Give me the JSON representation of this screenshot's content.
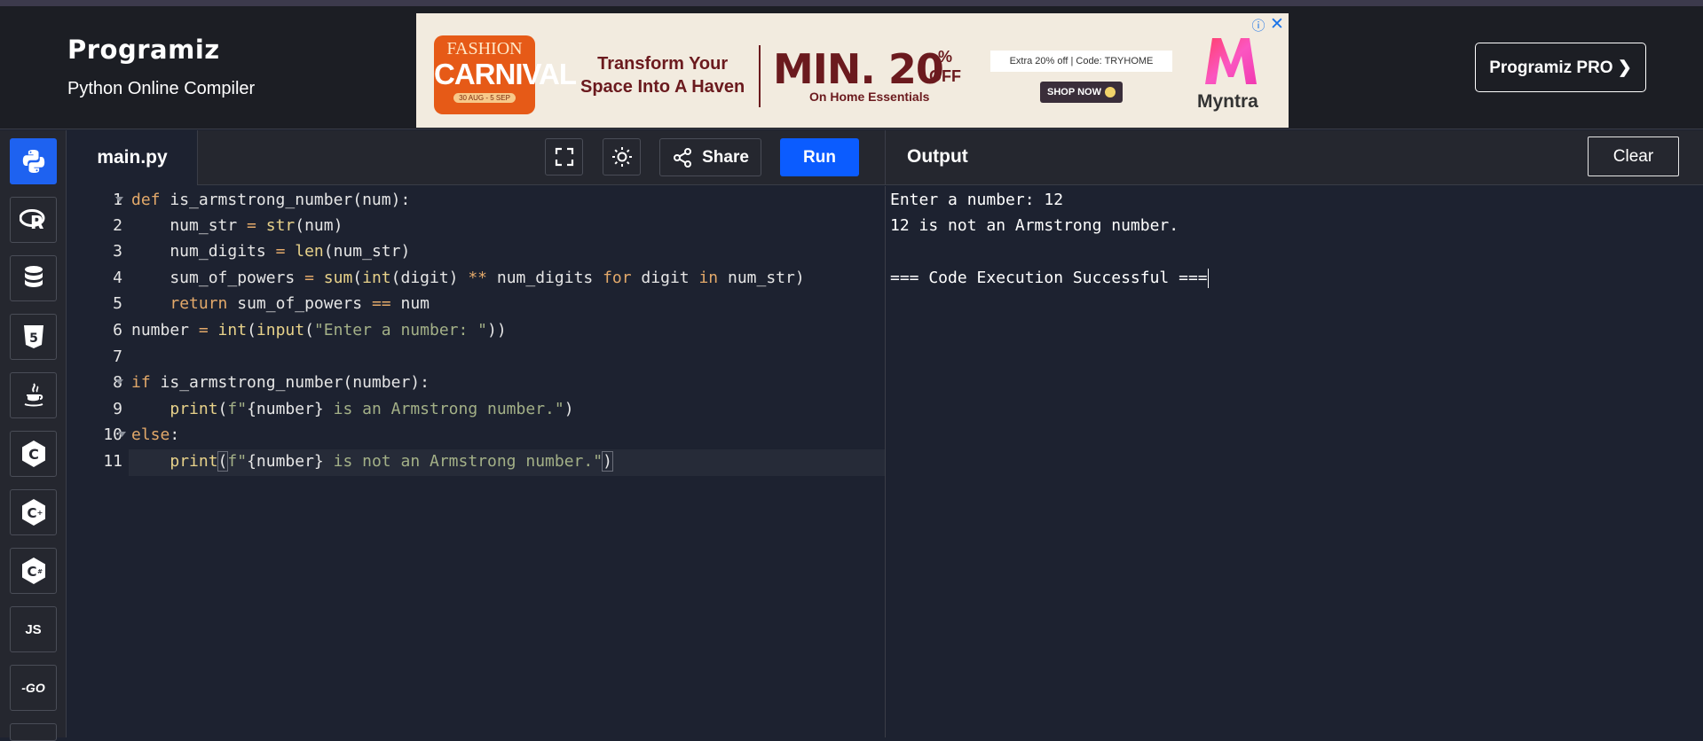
{
  "header": {
    "logo": "Programiz",
    "subtitle": "Python Online Compiler",
    "pro_button": "Programiz PRO ❯"
  },
  "ad": {
    "badge_top": "FASHION",
    "badge_main": "CARNIVAL",
    "badge_dates": "30 AUG - 5 SEP",
    "headline_1": "Transform Your",
    "headline_2": "Space Into A Haven",
    "min_text": "MIN. 20",
    "pct_1": "%",
    "pct_2": "OFF",
    "subtext": "On Home Essentials",
    "code_text": "Extra 20% off | Code: TRYHOME",
    "shop_now": "SHOP NOW",
    "brand": "Myntra",
    "info": "ⓘ",
    "close": "✕"
  },
  "sidebar": {
    "languages": [
      {
        "name": "python",
        "label": ""
      },
      {
        "name": "r",
        "label": "R"
      },
      {
        "name": "sql",
        "label": ""
      },
      {
        "name": "html",
        "label": "5"
      },
      {
        "name": "java",
        "label": ""
      },
      {
        "name": "c",
        "label": "C"
      },
      {
        "name": "cpp",
        "label": "C+"
      },
      {
        "name": "csharp",
        "label": "C#"
      },
      {
        "name": "js",
        "label": "JS"
      },
      {
        "name": "go",
        "label": "-GO"
      }
    ]
  },
  "editor": {
    "tab": "main.py",
    "share": "Share",
    "run": "Run",
    "line_numbers": [
      "1",
      "2",
      "3",
      "4",
      "5",
      "6",
      "7",
      "8",
      "9",
      "10",
      "11"
    ]
  },
  "output": {
    "title": "Output",
    "clear": "Clear",
    "lines": [
      "Enter a number: 12",
      "12 is not an Armstrong number.",
      "",
      "=== Code Execution Successful ==="
    ]
  }
}
